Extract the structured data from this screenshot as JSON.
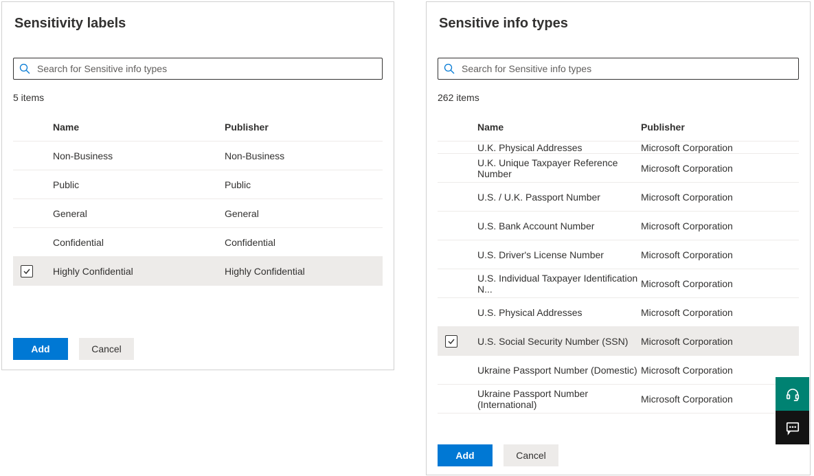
{
  "left": {
    "title": "Sensitivity labels",
    "searchPlaceholder": "Search for Sensitive info types",
    "count": "5 items",
    "headers": {
      "name": "Name",
      "publisher": "Publisher"
    },
    "rows": [
      {
        "name": "Non-Business",
        "publisher": "Non-Business",
        "selected": false
      },
      {
        "name": "Public",
        "publisher": "Public",
        "selected": false
      },
      {
        "name": "General",
        "publisher": "General",
        "selected": false
      },
      {
        "name": "Confidential",
        "publisher": "Confidential",
        "selected": false
      },
      {
        "name": "Highly Confidential",
        "publisher": "Highly Confidential",
        "selected": true
      }
    ],
    "add": "Add",
    "cancel": "Cancel"
  },
  "right": {
    "title": "Sensitive info types",
    "searchPlaceholder": "Search for Sensitive info types",
    "count": "262 items",
    "headers": {
      "name": "Name",
      "publisher": "Publisher"
    },
    "partial": {
      "name": "U.K. Physical Addresses",
      "publisher": "Microsoft Corporation"
    },
    "rows": [
      {
        "name": "U.K. Unique Taxpayer Reference Number",
        "publisher": "Microsoft Corporation",
        "selected": false
      },
      {
        "name": "U.S. / U.K. Passport Number",
        "publisher": "Microsoft Corporation",
        "selected": false
      },
      {
        "name": "U.S. Bank Account Number",
        "publisher": "Microsoft Corporation",
        "selected": false
      },
      {
        "name": "U.S. Driver's License Number",
        "publisher": "Microsoft Corporation",
        "selected": false
      },
      {
        "name": "U.S. Individual Taxpayer Identification N...",
        "publisher": "Microsoft Corporation",
        "selected": false
      },
      {
        "name": "U.S. Physical Addresses",
        "publisher": "Microsoft Corporation",
        "selected": false
      },
      {
        "name": "U.S. Social Security Number (SSN)",
        "publisher": "Microsoft Corporation",
        "selected": true
      },
      {
        "name": "Ukraine Passport Number (Domestic)",
        "publisher": "Microsoft Corporation",
        "selected": false
      },
      {
        "name": "Ukraine Passport Number (International)",
        "publisher": "Microsoft Corporation",
        "selected": false
      }
    ],
    "add": "Add",
    "cancel": "Cancel"
  }
}
